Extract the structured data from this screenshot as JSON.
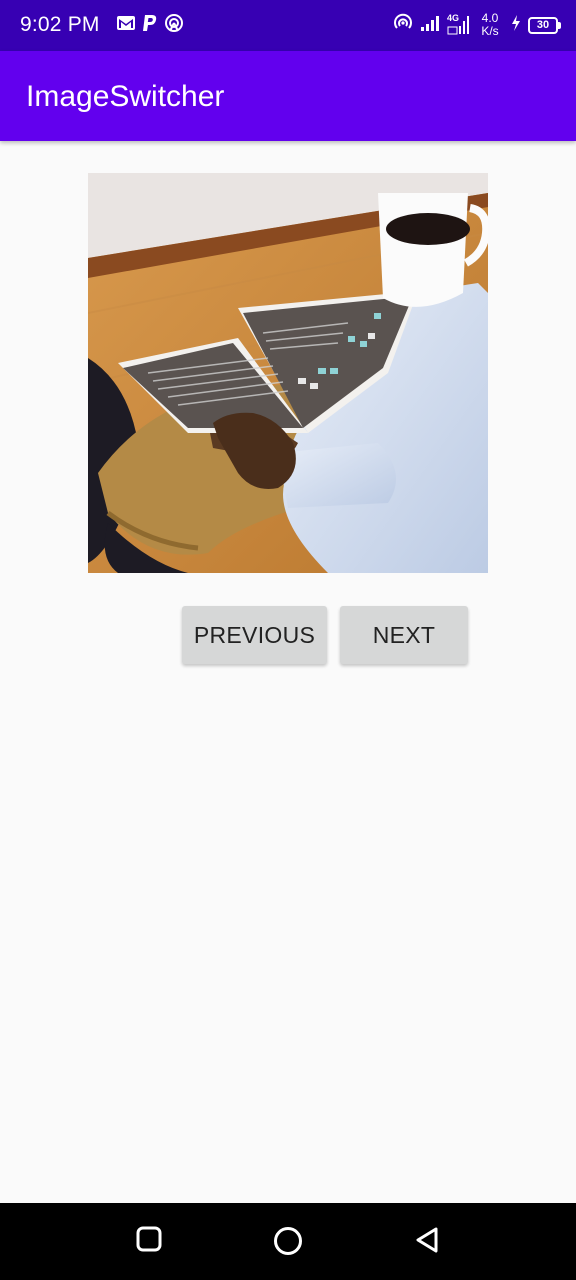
{
  "status_bar": {
    "time": "9:02 PM",
    "network_speed_value": "4.0",
    "network_speed_unit": "K/s",
    "network_type": "4G",
    "battery_level": "30",
    "notification_icons": [
      "gmail-icon",
      "paypal-icon",
      "hotspot-icon"
    ],
    "right_icons": [
      "hotspot-icon",
      "signal-icon",
      "4g-signal-icon",
      "charging-icon",
      "battery-icon"
    ]
  },
  "app_bar": {
    "title": "ImageSwitcher",
    "background": "#6200ee"
  },
  "image_switcher": {
    "image_description": "person holding coffee cup and reading magazine"
  },
  "buttons": {
    "previous_label": "PREVIOUS",
    "next_label": "NEXT"
  },
  "nav_bar": {
    "icons": [
      "recents-icon",
      "home-icon",
      "back-icon"
    ]
  },
  "colors": {
    "status_bar": "#3700b3",
    "app_bar": "#6200ee",
    "button": "#d6d7d7",
    "background": "#fafafa"
  }
}
